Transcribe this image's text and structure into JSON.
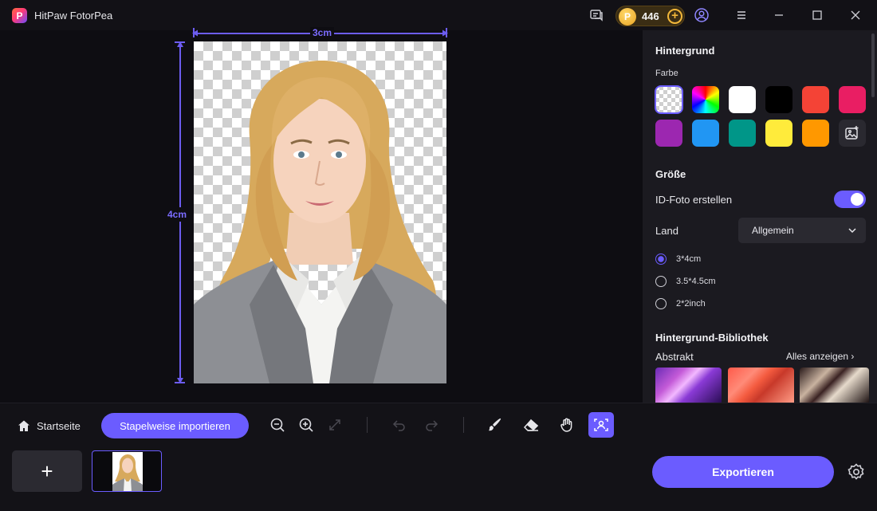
{
  "app": {
    "title": "HitPaw FotorPea",
    "logo_letter": "P",
    "credits": "446",
    "credit_coin_letter": "P"
  },
  "titlebar_icons": [
    "feedback-icon",
    "user-account-icon",
    "menu-icon",
    "minimize-icon",
    "maximize-icon",
    "close-icon"
  ],
  "canvas": {
    "width_label": "3cm",
    "height_label": "4cm"
  },
  "panel": {
    "background": {
      "title": "Hintergrund",
      "color_label": "Farbe",
      "swatches": [
        {
          "name": "transparent",
          "color": "transparent"
        },
        {
          "name": "rainbow",
          "color": "gradient"
        },
        {
          "name": "white",
          "color": "#ffffff"
        },
        {
          "name": "black",
          "color": "#000000"
        },
        {
          "name": "red",
          "color": "#f44336"
        },
        {
          "name": "pink",
          "color": "#e91e63"
        },
        {
          "name": "purple",
          "color": "#9c27b0"
        },
        {
          "name": "blue",
          "color": "#2196f3"
        },
        {
          "name": "teal",
          "color": "#009688"
        },
        {
          "name": "yellow",
          "color": "#ffeb3b"
        },
        {
          "name": "orange",
          "color": "#ff9800"
        },
        {
          "name": "custom-image",
          "color": "#2a2930"
        }
      ]
    },
    "size": {
      "title": "Größe",
      "id_photo_label": "ID-Foto erstellen",
      "id_photo_enabled": true,
      "country_label": "Land",
      "country_value": "Allgemein",
      "options": [
        "3*4cm",
        "3.5*4.5cm",
        "2*2inch"
      ],
      "selected_option": "3*4cm"
    },
    "library": {
      "title": "Hintergrund-Bibliothek",
      "category": "Abstrakt",
      "show_all": "Alles anzeigen"
    }
  },
  "toolbar": {
    "home_label": "Startseite",
    "batch_import_label": "Stapelweise importieren",
    "tools": [
      "zoom-out",
      "zoom-in",
      "fit-screen",
      "undo",
      "redo",
      "brush",
      "eraser",
      "hand",
      "id-photo"
    ],
    "active_tool": "id-photo",
    "add_label": "+",
    "export_label": "Exportieren"
  },
  "colors": {
    "accent": "#6b5cff",
    "panel_bg": "#1b1a20",
    "app_bg": "#0e0d12"
  }
}
